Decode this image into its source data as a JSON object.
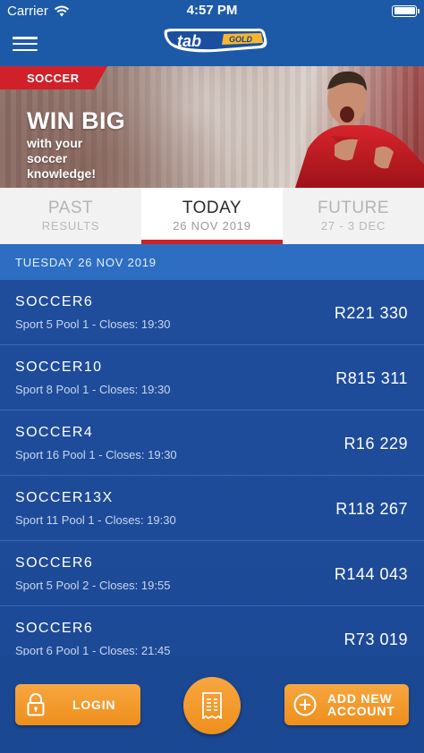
{
  "status_bar": {
    "carrier": "Carrier",
    "time": "4:57 PM"
  },
  "nav": {
    "logo_main": "tab",
    "logo_sub": "GOLD"
  },
  "banner": {
    "tag": "SOCCER",
    "title": "WIN BIG",
    "subtitle": "with your soccer knowledge!"
  },
  "tabs": [
    {
      "label": "PAST",
      "sub": "RESULTS",
      "active": false
    },
    {
      "label": "TODAY",
      "sub": "26 NOV 2019",
      "active": true
    },
    {
      "label": "FUTURE",
      "sub": "27 - 3 DEC",
      "active": false
    }
  ],
  "date_header": "TUESDAY 26 NOV 2019",
  "pools": [
    {
      "name": "SOCCER6",
      "detail": "Sport 5 Pool 1 - Closes: 19:30",
      "amount": "R221 330"
    },
    {
      "name": "SOCCER10",
      "detail": "Sport 8 Pool 1 - Closes: 19:30",
      "amount": "R815 311"
    },
    {
      "name": "SOCCER4",
      "detail": "Sport 16 Pool 1 - Closes: 19:30",
      "amount": "R16 229"
    },
    {
      "name": "SOCCER13X",
      "detail": "Sport 11 Pool 1 - Closes: 19:30",
      "amount": "R118 267"
    },
    {
      "name": "SOCCER6",
      "detail": "Sport 5 Pool 2 - Closes: 19:55",
      "amount": "R144 043"
    },
    {
      "name": "SOCCER6",
      "detail": "Sport 6 Pool 1 - Closes: 21:45",
      "amount": "R73 019"
    }
  ],
  "bottom": {
    "login_label": "LOGIN",
    "signup_line1": "ADD NEW",
    "signup_line2": "ACCOUNT"
  },
  "icons": {
    "menu": "hamburger-icon",
    "login": "lock-icon",
    "bet_slip": "receipt-icon",
    "signup": "plus-circle-icon",
    "wifi": "wifi-icon",
    "battery": "battery-icon"
  },
  "colors": {
    "brand_blue": "#1c5aa8",
    "accent_red": "#d0202a",
    "button_orange": "#f39a2c",
    "list_bg": "#1f4d9c"
  }
}
